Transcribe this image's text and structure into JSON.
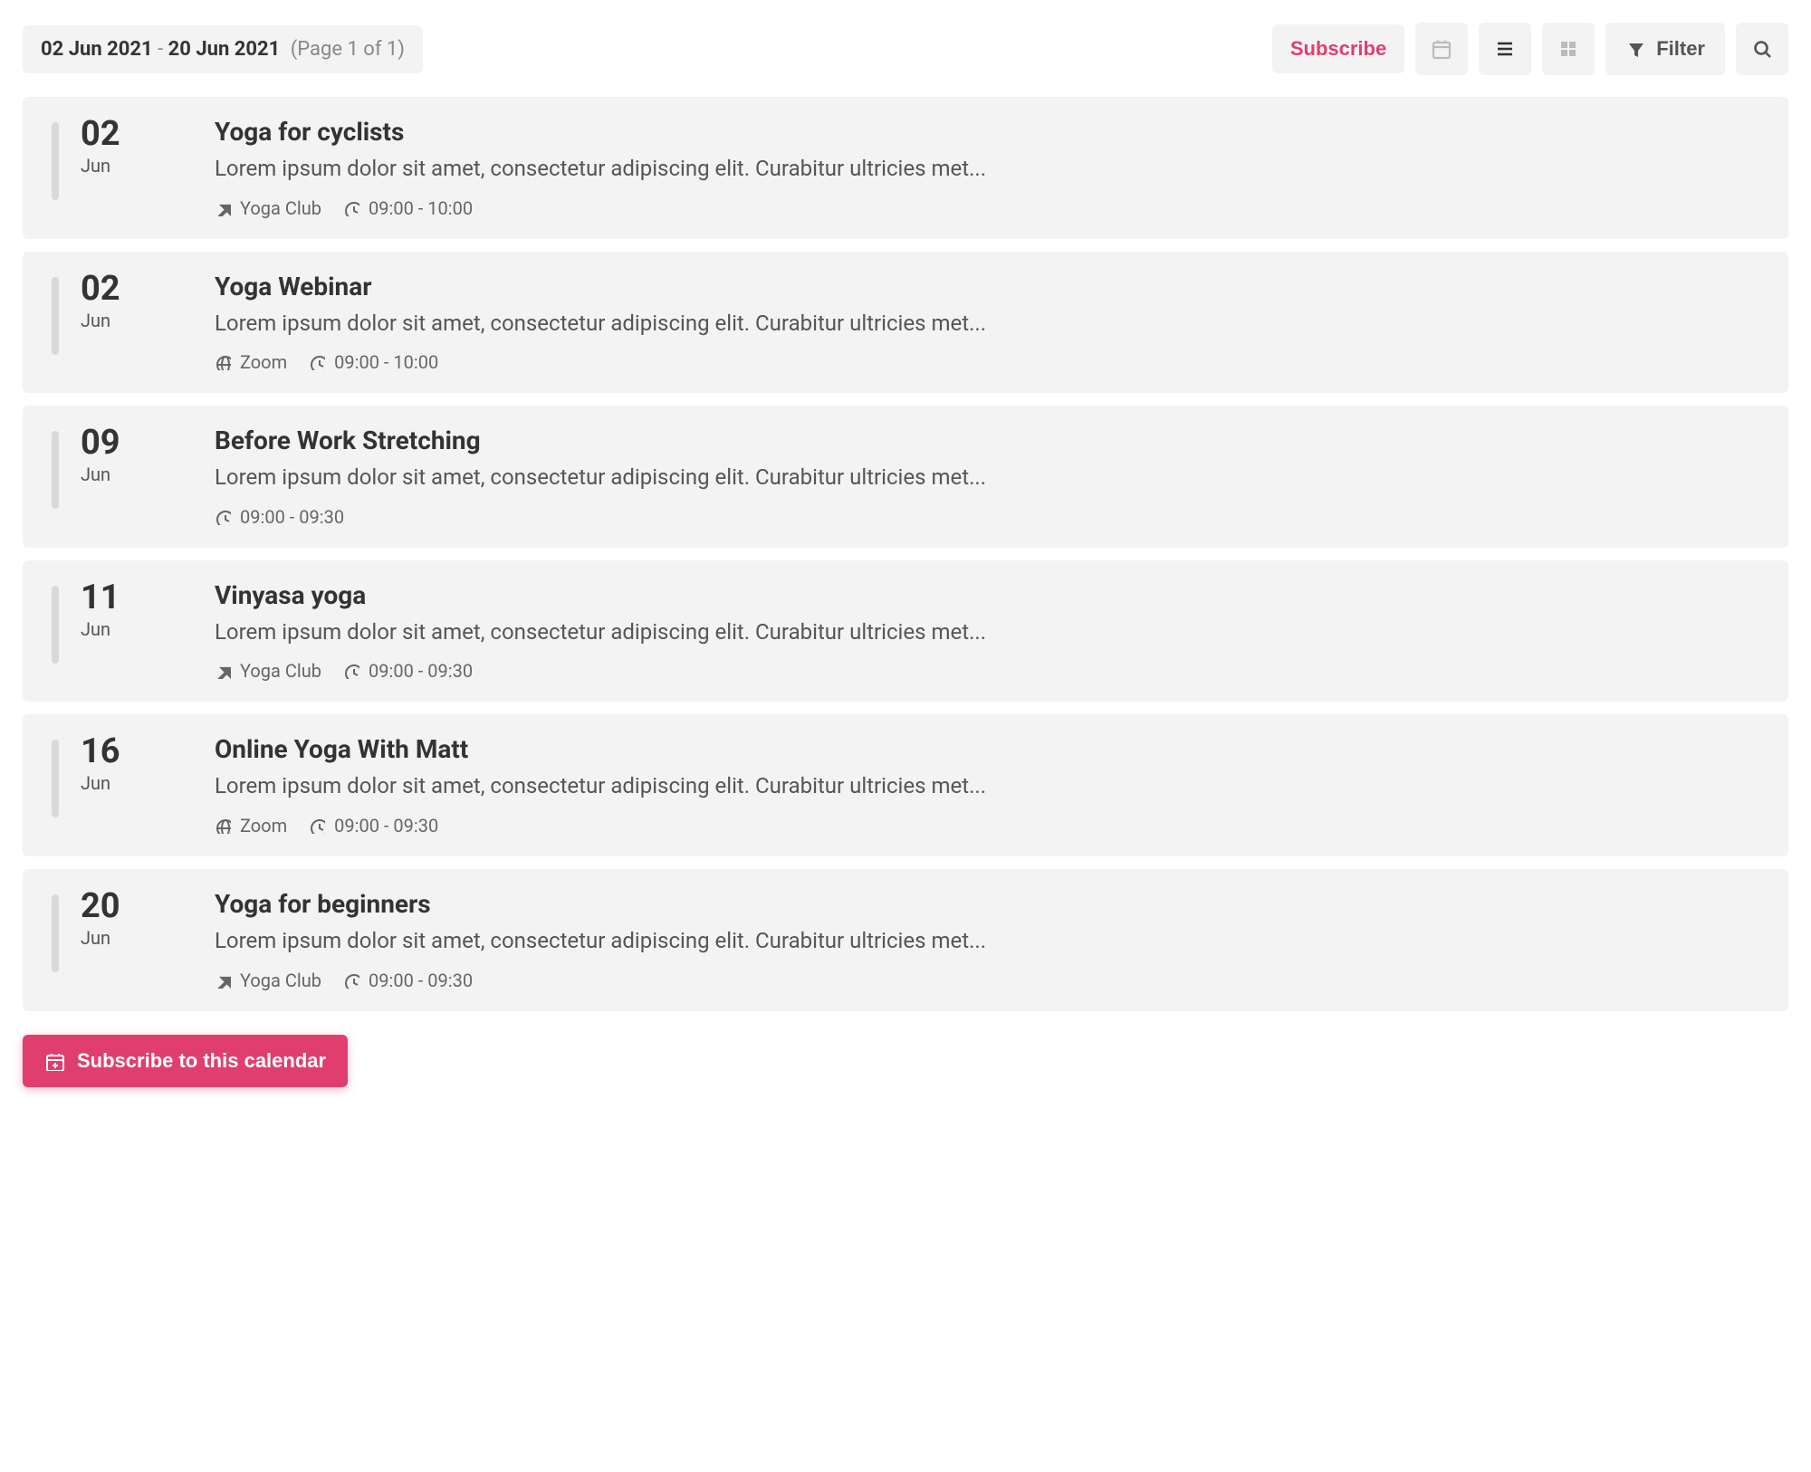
{
  "toolbar": {
    "date_from": "02 Jun 2021",
    "date_sep": " - ",
    "date_to": "20 Jun 2021",
    "page_info": "(Page 1 of 1)",
    "subscribe_label": "Subscribe",
    "filter_label": "Filter"
  },
  "events": [
    {
      "day": "02",
      "month": "Jun",
      "title": "Yoga for cyclists",
      "desc": "Lorem ipsum dolor sit amet, consectetur adipiscing elit. Curabitur ultricies met...",
      "location_type": "physical",
      "location": "Yoga Club",
      "time": "09:00 - 10:00"
    },
    {
      "day": "02",
      "month": "Jun",
      "title": "Yoga Webinar",
      "desc": "Lorem ipsum dolor sit amet, consectetur adipiscing elit. Curabitur ultricies met...",
      "location_type": "online",
      "location": "Zoom",
      "time": "09:00 - 10:00"
    },
    {
      "day": "09",
      "month": "Jun",
      "title": "Before Work Stretching",
      "desc": "Lorem ipsum dolor sit amet, consectetur adipiscing elit. Curabitur ultricies met...",
      "location_type": "none",
      "location": "",
      "time": "09:00 - 09:30"
    },
    {
      "day": "11",
      "month": "Jun",
      "title": "Vinyasa yoga",
      "desc": "Lorem ipsum dolor sit amet, consectetur adipiscing elit. Curabitur ultricies met...",
      "location_type": "physical",
      "location": "Yoga Club",
      "time": "09:00 - 09:30"
    },
    {
      "day": "16",
      "month": "Jun",
      "title": "Online Yoga With Matt",
      "desc": "Lorem ipsum dolor sit amet, consectetur adipiscing elit. Curabitur ultricies met...",
      "location_type": "online",
      "location": "Zoom",
      "time": "09:00 - 09:30"
    },
    {
      "day": "20",
      "month": "Jun",
      "title": "Yoga for beginners",
      "desc": "Lorem ipsum dolor sit amet, consectetur adipiscing elit. Curabitur ultricies met...",
      "location_type": "physical",
      "location": "Yoga Club",
      "time": "09:00 - 09:30"
    }
  ],
  "footer": {
    "subscribe_calendar_label": "Subscribe to this calendar"
  }
}
